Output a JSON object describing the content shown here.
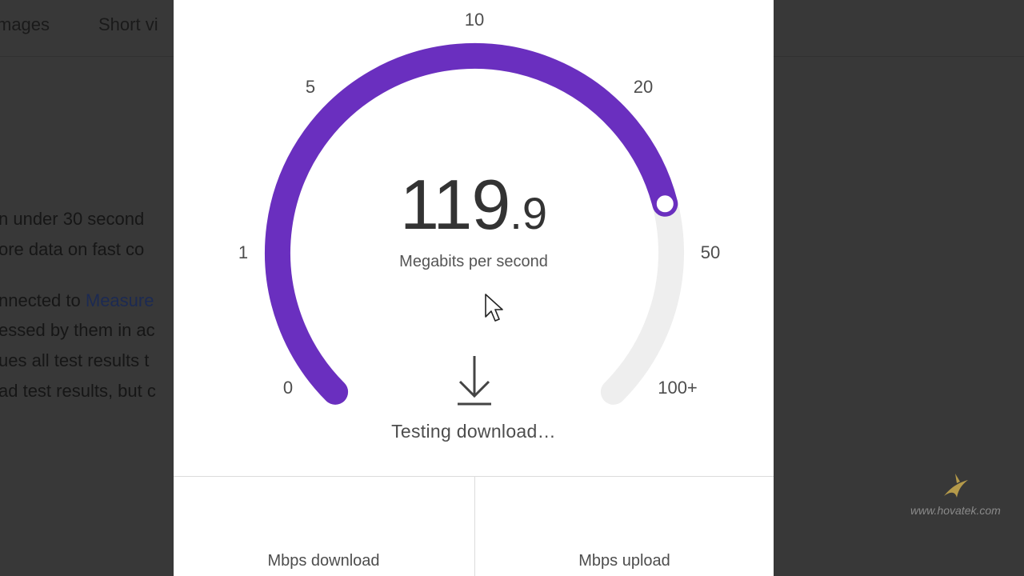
{
  "background": {
    "tabs": [
      "mages",
      "Short vi"
    ],
    "lines": [
      {
        "text": "n under 30 second"
      },
      {
        "text": "ore data on fast co"
      },
      {
        "pre": "nnected to ",
        "link": "Measure"
      },
      {
        "text": "essed by them in ac"
      },
      {
        "text": "ues all test results t"
      },
      {
        "text": "ad test results, but c"
      }
    ]
  },
  "speedtest": {
    "ticks": [
      "0",
      "1",
      "5",
      "10",
      "20",
      "50",
      "100+"
    ],
    "speed_integer": "119",
    "speed_decimal": ".9",
    "unit_label": "Megabits per second",
    "status": "Testing download…",
    "download_label": "Mbps download",
    "upload_label": "Mbps upload",
    "gauge_progress_fraction": 0.78,
    "colors": {
      "accent": "#6a2fbf",
      "track": "#eeeeee",
      "card": "#ffffff"
    },
    "icons": {
      "download": "download-arrow-icon",
      "cursor": "mouse-pointer-icon"
    }
  },
  "watermark": {
    "text": "www.hovatek.com",
    "logo": "hovatek-logo-icon"
  }
}
